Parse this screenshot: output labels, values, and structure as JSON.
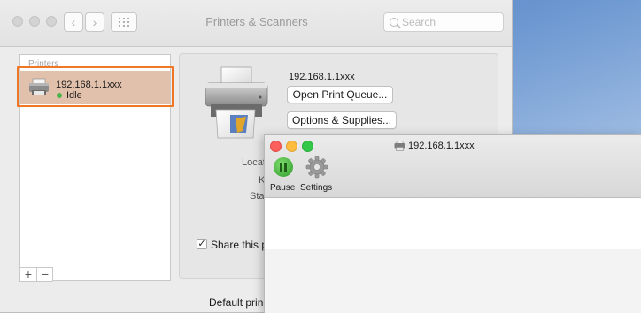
{
  "window": {
    "title": "Printers & Scanners",
    "search_placeholder": "Search",
    "nav": {
      "back": "‹",
      "forward": "›"
    }
  },
  "sidebar": {
    "header": "Printers",
    "printers": [
      {
        "name": "192.168.1.1xxx",
        "status": "Idle",
        "status_color": "#4bb34b"
      }
    ],
    "add_label": "+",
    "remove_label": "−"
  },
  "detail": {
    "printer_name": "192.168.1.1xxx",
    "open_queue_label": "Open Print Queue...",
    "options_label": "Options & Supplies...",
    "location_label": "Locat",
    "kind_label": "K",
    "status_label": "Sta",
    "share_label": "Share this p",
    "share_checked": "✓",
    "default_printer_label": "Default prin"
  },
  "queue_window": {
    "title": "192.168.1.1xxx",
    "pause_label": "Pause",
    "settings_label": "Settings"
  },
  "colors": {
    "selection": "#e2c1ac",
    "highlight_border": "#f07825",
    "close": "#fc605c",
    "minimize": "#fdbc40",
    "zoom": "#34c84a"
  }
}
